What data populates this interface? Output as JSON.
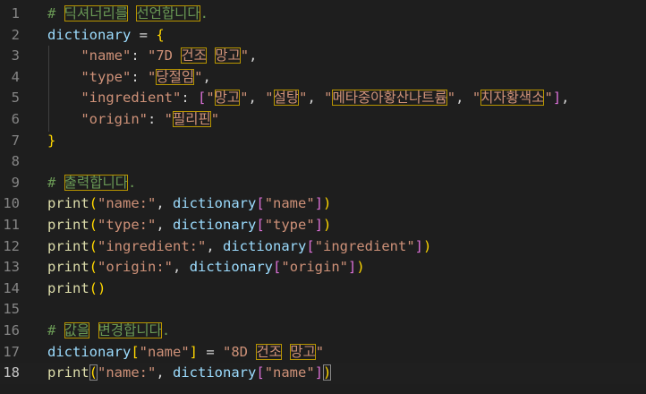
{
  "editor": {
    "language": "python",
    "current_line": 18,
    "colors": {
      "background": "#1e1e1e",
      "comment": "#6a9955",
      "variable": "#9cdcfe",
      "string": "#ce9178",
      "function": "#dcdcaa",
      "bracket_level1": "#ffd700",
      "bracket_level2": "#da70d6",
      "bracket_level3": "#179fff",
      "unicode_highlight_box": "#b89500"
    },
    "lines": [
      {
        "n": "1",
        "tokens": [
          {
            "t": "# ",
            "c": "t-comment"
          },
          {
            "t": "딕셔너리를",
            "c": "t-comment",
            "hl": true
          },
          {
            "t": " ",
            "c": "t-comment"
          },
          {
            "t": "선언합니다",
            "c": "t-comment",
            "hl": true
          },
          {
            "t": ".",
            "c": "t-comment"
          }
        ]
      },
      {
        "n": "2",
        "tokens": [
          {
            "t": "dictionary",
            "c": "t-var"
          },
          {
            "t": " = ",
            "c": "t-op"
          },
          {
            "t": "{",
            "c": "t-brace1"
          }
        ]
      },
      {
        "n": "3",
        "tokens": [
          {
            "t": "    ",
            "c": "t-op"
          },
          {
            "t": "\"name\"",
            "c": "t-str"
          },
          {
            "t": ": ",
            "c": "t-punc"
          },
          {
            "t": "\"7D ",
            "c": "t-str"
          },
          {
            "t": "건조",
            "c": "t-str",
            "hl": true
          },
          {
            "t": " ",
            "c": "t-str"
          },
          {
            "t": "망고",
            "c": "t-str",
            "hl": true
          },
          {
            "t": "\"",
            "c": "t-str"
          },
          {
            "t": ",",
            "c": "t-punc"
          }
        ]
      },
      {
        "n": "4",
        "tokens": [
          {
            "t": "    ",
            "c": "t-op"
          },
          {
            "t": "\"type\"",
            "c": "t-str"
          },
          {
            "t": ": ",
            "c": "t-punc"
          },
          {
            "t": "\"",
            "c": "t-str"
          },
          {
            "t": "당절임",
            "c": "t-str",
            "hl": true
          },
          {
            "t": "\"",
            "c": "t-str"
          },
          {
            "t": ",",
            "c": "t-punc"
          }
        ]
      },
      {
        "n": "5",
        "tokens": [
          {
            "t": "    ",
            "c": "t-op"
          },
          {
            "t": "\"ingredient\"",
            "c": "t-str"
          },
          {
            "t": ": ",
            "c": "t-punc"
          },
          {
            "t": "[",
            "c": "t-brace2"
          },
          {
            "t": "\"",
            "c": "t-str"
          },
          {
            "t": "망고",
            "c": "t-str",
            "hl": true
          },
          {
            "t": "\"",
            "c": "t-str"
          },
          {
            "t": ", ",
            "c": "t-punc"
          },
          {
            "t": "\"",
            "c": "t-str"
          },
          {
            "t": "설탕",
            "c": "t-str",
            "hl": true
          },
          {
            "t": "\"",
            "c": "t-str"
          },
          {
            "t": ", ",
            "c": "t-punc"
          },
          {
            "t": "\"",
            "c": "t-str"
          },
          {
            "t": "메타중아황산나트륨",
            "c": "t-str",
            "hl": true
          },
          {
            "t": "\"",
            "c": "t-str"
          },
          {
            "t": ", ",
            "c": "t-punc"
          },
          {
            "t": "\"",
            "c": "t-str"
          },
          {
            "t": "치자황색소",
            "c": "t-str",
            "hl": true
          },
          {
            "t": "\"",
            "c": "t-str"
          },
          {
            "t": "]",
            "c": "t-brace2"
          },
          {
            "t": ",",
            "c": "t-punc"
          }
        ]
      },
      {
        "n": "6",
        "tokens": [
          {
            "t": "    ",
            "c": "t-op"
          },
          {
            "t": "\"origin\"",
            "c": "t-str"
          },
          {
            "t": ": ",
            "c": "t-punc"
          },
          {
            "t": "\"",
            "c": "t-str"
          },
          {
            "t": "필리핀",
            "c": "t-str",
            "hl": true
          },
          {
            "t": "\"",
            "c": "t-str"
          }
        ]
      },
      {
        "n": "7",
        "tokens": [
          {
            "t": "}",
            "c": "t-brace1"
          }
        ]
      },
      {
        "n": "8",
        "tokens": []
      },
      {
        "n": "9",
        "tokens": [
          {
            "t": "# ",
            "c": "t-comment"
          },
          {
            "t": "출력합니다",
            "c": "t-comment",
            "hl": true
          },
          {
            "t": ".",
            "c": "t-comment"
          }
        ]
      },
      {
        "n": "10",
        "tokens": [
          {
            "t": "print",
            "c": "t-func"
          },
          {
            "t": "(",
            "c": "t-brace1"
          },
          {
            "t": "\"name:\"",
            "c": "t-str"
          },
          {
            "t": ", ",
            "c": "t-punc"
          },
          {
            "t": "dictionary",
            "c": "t-var"
          },
          {
            "t": "[",
            "c": "t-brace2"
          },
          {
            "t": "\"name\"",
            "c": "t-str"
          },
          {
            "t": "]",
            "c": "t-brace2"
          },
          {
            "t": ")",
            "c": "t-brace1"
          }
        ]
      },
      {
        "n": "11",
        "tokens": [
          {
            "t": "print",
            "c": "t-func"
          },
          {
            "t": "(",
            "c": "t-brace1"
          },
          {
            "t": "\"type:\"",
            "c": "t-str"
          },
          {
            "t": ", ",
            "c": "t-punc"
          },
          {
            "t": "dictionary",
            "c": "t-var"
          },
          {
            "t": "[",
            "c": "t-brace2"
          },
          {
            "t": "\"type\"",
            "c": "t-str"
          },
          {
            "t": "]",
            "c": "t-brace2"
          },
          {
            "t": ")",
            "c": "t-brace1"
          }
        ]
      },
      {
        "n": "12",
        "tokens": [
          {
            "t": "print",
            "c": "t-func"
          },
          {
            "t": "(",
            "c": "t-brace1"
          },
          {
            "t": "\"ingredient:\"",
            "c": "t-str"
          },
          {
            "t": ", ",
            "c": "t-punc"
          },
          {
            "t": "dictionary",
            "c": "t-var"
          },
          {
            "t": "[",
            "c": "t-brace2"
          },
          {
            "t": "\"ingredient\"",
            "c": "t-str"
          },
          {
            "t": "]",
            "c": "t-brace2"
          },
          {
            "t": ")",
            "c": "t-brace1"
          }
        ]
      },
      {
        "n": "13",
        "tokens": [
          {
            "t": "print",
            "c": "t-func"
          },
          {
            "t": "(",
            "c": "t-brace1"
          },
          {
            "t": "\"origin:\"",
            "c": "t-str"
          },
          {
            "t": ", ",
            "c": "t-punc"
          },
          {
            "t": "dictionary",
            "c": "t-var"
          },
          {
            "t": "[",
            "c": "t-brace2"
          },
          {
            "t": "\"origin\"",
            "c": "t-str"
          },
          {
            "t": "]",
            "c": "t-brace2"
          },
          {
            "t": ")",
            "c": "t-brace1"
          }
        ]
      },
      {
        "n": "14",
        "tokens": [
          {
            "t": "print",
            "c": "t-func"
          },
          {
            "t": "()",
            "c": "t-brace1"
          }
        ]
      },
      {
        "n": "15",
        "tokens": []
      },
      {
        "n": "16",
        "tokens": [
          {
            "t": "# ",
            "c": "t-comment"
          },
          {
            "t": "값을",
            "c": "t-comment",
            "hl": true
          },
          {
            "t": " ",
            "c": "t-comment"
          },
          {
            "t": "변경합니다",
            "c": "t-comment",
            "hl": true
          },
          {
            "t": ".",
            "c": "t-comment"
          }
        ]
      },
      {
        "n": "17",
        "tokens": [
          {
            "t": "dictionary",
            "c": "t-var"
          },
          {
            "t": "[",
            "c": "t-brace1"
          },
          {
            "t": "\"name\"",
            "c": "t-str"
          },
          {
            "t": "]",
            "c": "t-brace1"
          },
          {
            "t": " = ",
            "c": "t-op"
          },
          {
            "t": "\"8D ",
            "c": "t-str"
          },
          {
            "t": "건조",
            "c": "t-str",
            "hl": true
          },
          {
            "t": " ",
            "c": "t-str"
          },
          {
            "t": "망고",
            "c": "t-str",
            "hl": true
          },
          {
            "t": "\"",
            "c": "t-str"
          }
        ]
      },
      {
        "n": "18",
        "tokens": [
          {
            "t": "print",
            "c": "t-func"
          },
          {
            "t": "(",
            "c": "t-brace1",
            "match": true
          },
          {
            "t": "\"name:\"",
            "c": "t-str"
          },
          {
            "t": ", ",
            "c": "t-punc"
          },
          {
            "t": "dictionary",
            "c": "t-var"
          },
          {
            "t": "[",
            "c": "t-brace2"
          },
          {
            "t": "\"name\"",
            "c": "t-str"
          },
          {
            "t": "]",
            "c": "t-brace2"
          },
          {
            "t": ")",
            "c": "t-brace1",
            "match": true
          }
        ]
      }
    ]
  }
}
